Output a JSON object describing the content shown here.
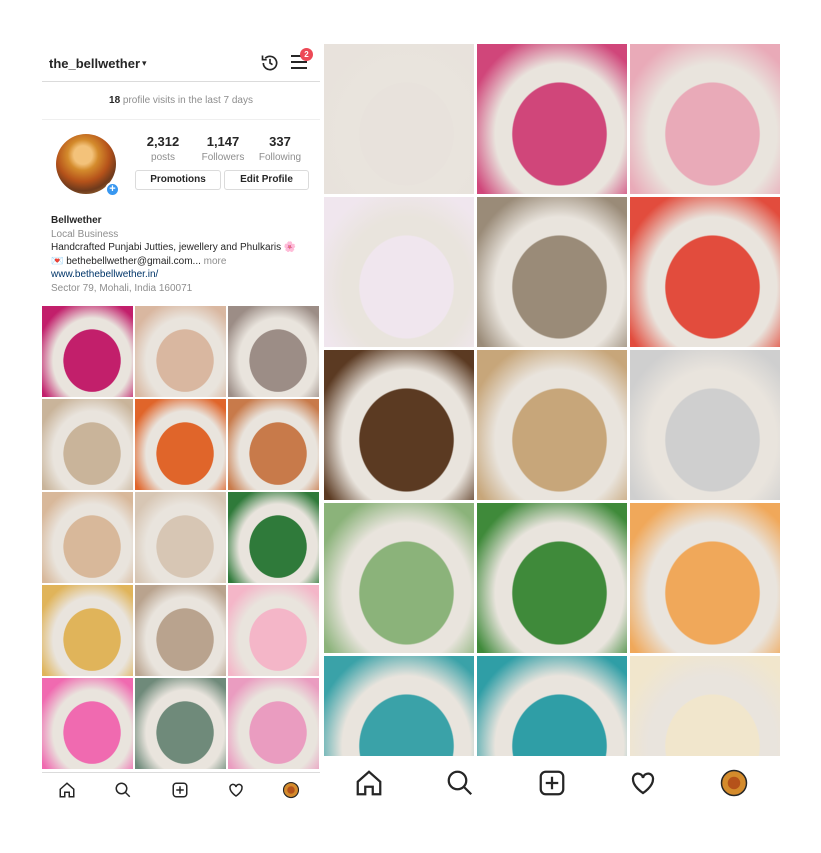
{
  "profile": {
    "username": "the_bellwether",
    "caret": "▾",
    "notification_count": "2",
    "visits_count": "18",
    "visits_text": " profile visits in the last 7 days",
    "stats": [
      {
        "num": "2,312",
        "label": "posts"
      },
      {
        "num": "1,147",
        "label": "Followers"
      },
      {
        "num": "337",
        "label": "Following"
      }
    ],
    "promotions_label": "Promotions",
    "edit_profile_label": "Edit Profile",
    "bio": {
      "name": "Bellwether",
      "category": "Local Business",
      "line1": "Handcrafted Punjabi Jutties, jewellery and Phulkaris 🌸",
      "email": "💌 bethebellwether@gmail.com...",
      "more": " more",
      "website": "www.bethebellwether.in/",
      "address": "Sector 79, Mohali, India 160071"
    }
  },
  "colors": {
    "left_tiles": [
      "#c21f6b",
      "#d9b7a0",
      "#9c8d86",
      "#c9b49a",
      "#e0652a",
      "#c87a4a",
      "#d8b89a",
      "#d7c6b4",
      "#2f7a3a",
      "#e0b45a",
      "#b9a38e",
      "#f4b6c8",
      "#f06ab0",
      "#6f8a7a",
      "#ea9cc0"
    ],
    "right_tiles": [
      "#e8e2dc",
      "#d0467a",
      "#e9aab8",
      "#f0e6ee",
      "#9a8b78",
      "#e24c3d",
      "#5b3a22",
      "#c7a67a",
      "#cfcfcf",
      "#8bb37a",
      "#3f8a3a",
      "#f0a85a",
      "#3aa2a8",
      "#2f9ea6",
      "#f1e6cc"
    ],
    "accent_blue": "#3897f0",
    "badge_red": "#ed4956"
  },
  "nav": {
    "icons": [
      "home-icon",
      "search-icon",
      "add-post-icon",
      "heart-icon",
      "profile-avatar-icon"
    ]
  }
}
